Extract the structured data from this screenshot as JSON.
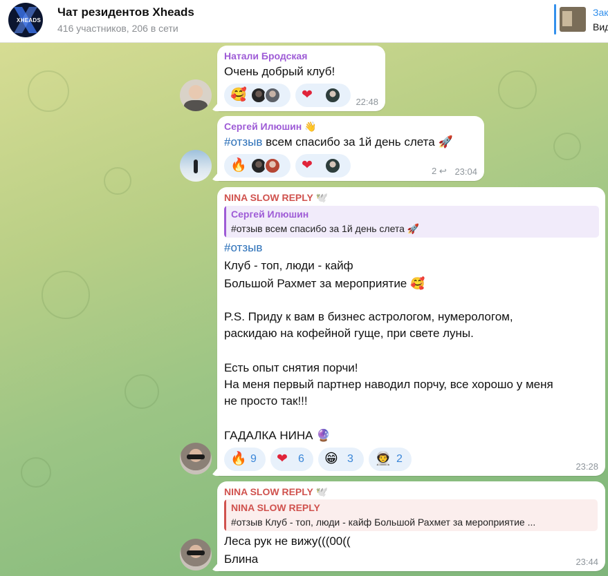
{
  "header": {
    "chat_title": "Чат резидентов Xheads",
    "subtitle": "416 участников, 206 в сети",
    "avatar_text": "XHEADS",
    "pinned_title": "Зак",
    "pinned_text": "Вид"
  },
  "colors": {
    "accent": "#3390ec",
    "sender_violet": "#9e5bd6",
    "sender_red": "#d0524e",
    "hashtag": "#2a6fb8",
    "reaction_bg": "#e8f1fb"
  },
  "messages": [
    {
      "sender": "Натали Бродская",
      "text": "Очень добрый клуб!",
      "reactions": [
        {
          "emoji": "🥰",
          "avatars": [
            "dark",
            "grey"
          ]
        },
        {
          "emoji": "❤",
          "avatars": [
            "teal"
          ]
        }
      ],
      "time": "22:48"
    },
    {
      "sender": "Сергей Илюшин 👋",
      "hashtag": "#отзыв",
      "text": " всем спасибо за 1й день слета 🚀",
      "reactions": [
        {
          "emoji": "🔥",
          "avatars": [
            "dark",
            "red"
          ]
        },
        {
          "emoji": "❤",
          "avatars": [
            "teal"
          ]
        }
      ],
      "replies": "2",
      "time": "23:04"
    },
    {
      "sender": "NINA SLOW REPLY 🕊️",
      "reply_to": {
        "name": "Сергей Илюшин",
        "text": "#отзыв всем спасибо за 1й день слета 🚀"
      },
      "lines": [
        "#отзыв",
        "Клуб - топ, люди - кайф",
        "Большой Рахмет за мероприятие 🥰",
        "P.S. Приду к вам в бизнес астрологом, нумерологом,",
        "раскидаю на кофейной гуще, при свете луны.",
        "Есть опыт снятия порчи!",
        "На меня первый партнер наводил порчу, все хорошо у меня",
        "не просто так!!!",
        "ГАДАЛКА НИНА 🔮"
      ],
      "reactions": [
        {
          "emoji": "🔥",
          "count": "9"
        },
        {
          "emoji": "❤",
          "count": "6"
        },
        {
          "emoji": "😁",
          "count": "3"
        },
        {
          "emoji": "👨‍🚀",
          "count": "2"
        }
      ],
      "time": "23:28"
    },
    {
      "sender": "NINA SLOW REPLY 🕊️",
      "reply_to": {
        "name": "NINA SLOW REPLY",
        "text": "#отзыв Клуб - топ, люди - кайф Большой Рахмет за мероприятие ..."
      },
      "lines": [
        "Леса рук не вижу(((00((",
        "Блина"
      ],
      "time": "23:44"
    }
  ]
}
